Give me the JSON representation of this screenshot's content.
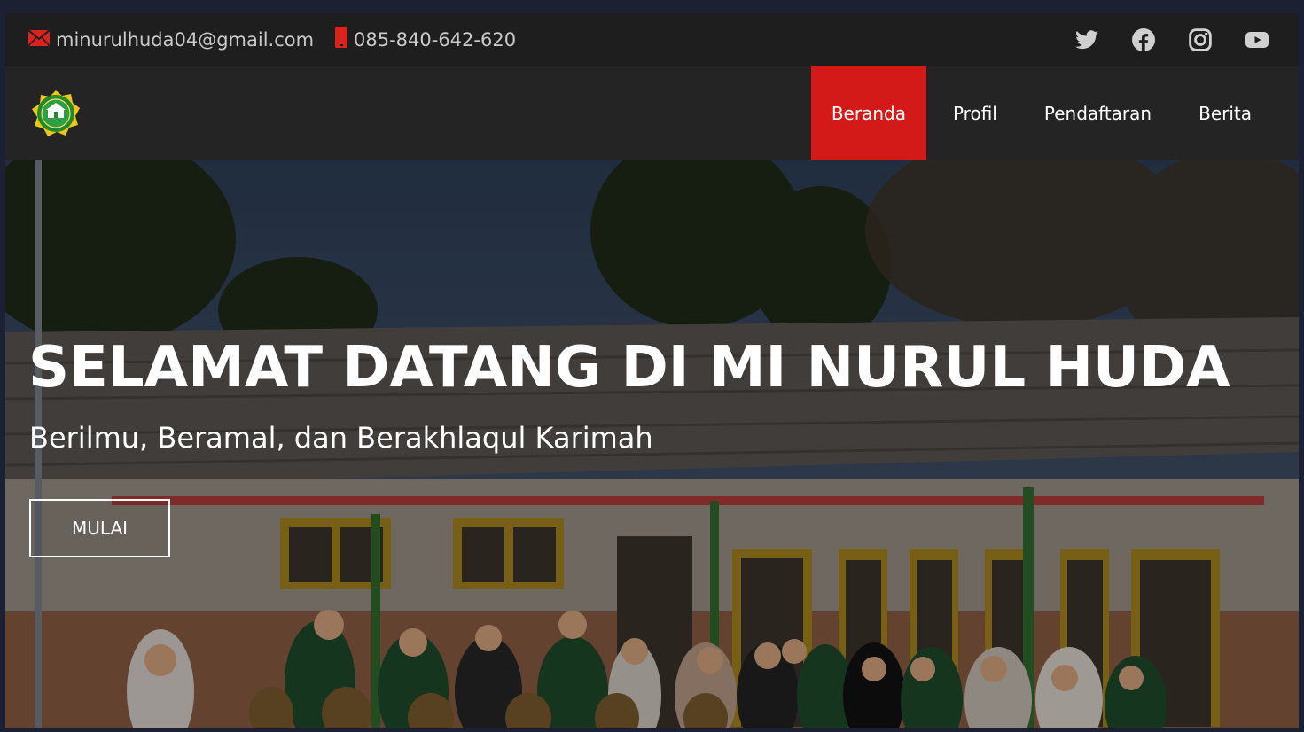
{
  "topbar": {
    "email": "minurulhuda04@gmail.com",
    "phone": "085-840-642-620",
    "socials": [
      "twitter-icon",
      "facebook-icon",
      "instagram-icon",
      "youtube-icon"
    ]
  },
  "nav": {
    "items": [
      {
        "label": "Beranda",
        "active": true
      },
      {
        "label": "Profil",
        "active": false
      },
      {
        "label": "Pendaftaran",
        "active": false
      },
      {
        "label": "Berita",
        "active": false
      }
    ]
  },
  "hero": {
    "title": "SELAMAT DATANG DI MI NURUL HUDA",
    "subtitle": "Berilmu, Beramal, dan Berakhlaqul Karimah",
    "button": "MULAI"
  },
  "colors": {
    "accent": "#d41919",
    "topbar_bg": "#1e1e1e",
    "navbar_bg": "#242424"
  }
}
